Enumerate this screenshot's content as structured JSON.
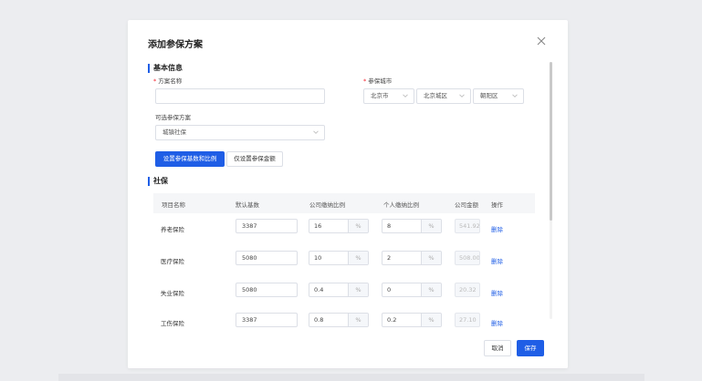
{
  "dialog": {
    "title": "添加参保方案"
  },
  "basic_info": {
    "section_title": "基本信息",
    "plan_name": {
      "label": "方案名称",
      "value": "",
      "placeholder": ""
    },
    "city": {
      "label": "参保城市",
      "province": "北京市",
      "city": "北京城区",
      "district": "朝阳区"
    },
    "optional_plan": {
      "label": "可选参保方案",
      "value": "城镇社保"
    }
  },
  "mode_buttons": {
    "base_and_ratio": "设置参保基数和比例",
    "amount_only": "仅设置参保金额"
  },
  "social": {
    "section_title": "社保",
    "columns": [
      "项目名称",
      "默认基数",
      "公司缴纳比例",
      "个人缴纳比例",
      "公司金额",
      "操作"
    ],
    "pct_unit": "%",
    "delete_label": "删除",
    "rows": [
      {
        "name": "养老保险",
        "base": "3387",
        "company_ratio": "16",
        "personal_ratio": "8",
        "company_amount": "541.92"
      },
      {
        "name": "医疗保险",
        "base": "5080",
        "company_ratio": "10",
        "personal_ratio": "2",
        "company_amount": "508.00"
      },
      {
        "name": "失业保险",
        "base": "5080",
        "company_ratio": "0.4",
        "personal_ratio": "0",
        "company_amount": "20.32"
      },
      {
        "name": "工伤保险",
        "base": "3387",
        "company_ratio": "0.8",
        "personal_ratio": "0.2",
        "company_amount": "27.10"
      }
    ]
  },
  "footer": {
    "cancel": "取消",
    "save": "保存"
  },
  "icons": {
    "close": "close-icon",
    "chevron": "chevron-down-icon"
  },
  "colors": {
    "primary": "#1f5ee6",
    "required": "#f5222d"
  }
}
